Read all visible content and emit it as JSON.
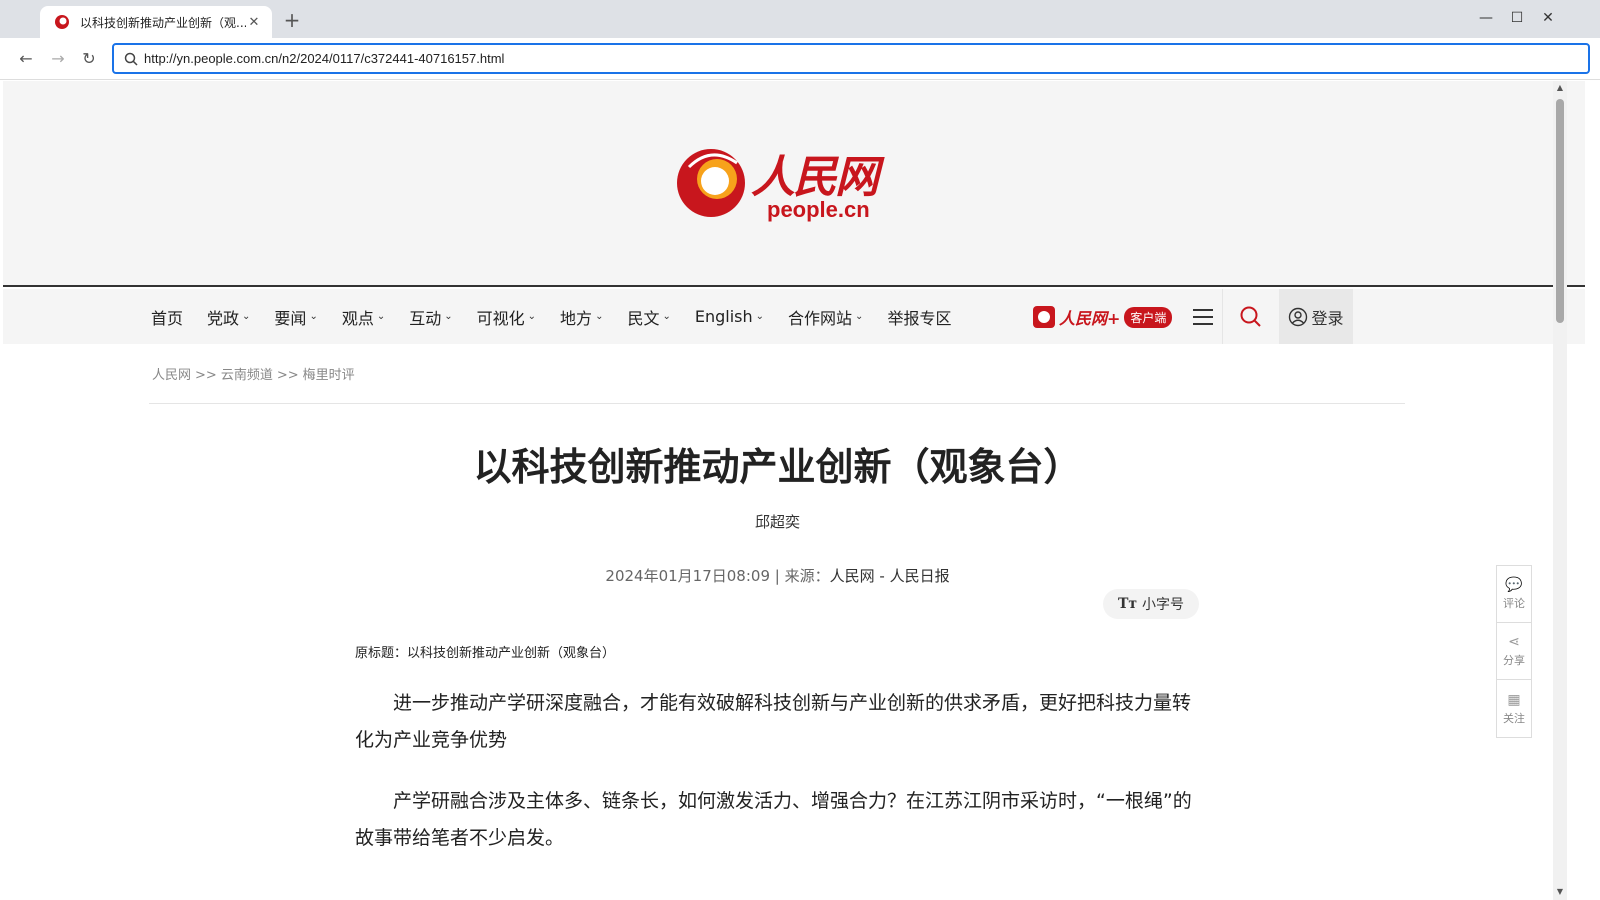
{
  "browser": {
    "tab_title": "以科技创新推动产业创新（观...",
    "tab_close": "✕",
    "new_tab": "+",
    "url": "http://yn.people.com.cn/n2/2024/0117/c372441-40716157.html",
    "window_controls": {
      "minimize": "—",
      "maximize": "☐",
      "close": "✕"
    },
    "nav": {
      "back": "←",
      "forward": "→",
      "reload": "↻"
    }
  },
  "site": {
    "logo_cn": "人民网",
    "logo_en": "people.cn"
  },
  "nav": {
    "items": [
      {
        "label": "首页",
        "dropdown": false
      },
      {
        "label": "党政",
        "dropdown": true
      },
      {
        "label": "要闻",
        "dropdown": true
      },
      {
        "label": "观点",
        "dropdown": true
      },
      {
        "label": "互动",
        "dropdown": true
      },
      {
        "label": "可视化",
        "dropdown": true
      },
      {
        "label": "地方",
        "dropdown": true
      },
      {
        "label": "民文",
        "dropdown": true
      },
      {
        "label": "English",
        "dropdown": true
      },
      {
        "label": "合作网站",
        "dropdown": true
      },
      {
        "label": "举报专区",
        "dropdown": false
      }
    ],
    "app_name": "人民网+",
    "app_tag": "客户端",
    "login": "登录"
  },
  "breadcrumb": [
    "人民网",
    ">>",
    "云南频道",
    ">>",
    "梅里时评"
  ],
  "article": {
    "title": "以科技创新推动产业创新（观象台）",
    "author": "邱超奕",
    "date": "2024年01月17日08:09",
    "separator": "|",
    "source_label": "来源：",
    "source": "人民网 - 人民日报",
    "font_toggle_icon": "Tт",
    "font_toggle": "小字号",
    "original_title": "原标题：以科技创新推动产业创新（观象台）",
    "paragraphs": [
      "进一步推动产学研深度融合，才能有效破解科技创新与产业创新的供求矛盾，更好把科技力量转化为产业竞争优势",
      "产学研融合涉及主体多、链条长，如何激发活力、增强合力？在江苏江阴市采访时，“一根绳”的故事带给笔者不少启发。"
    ]
  },
  "side_tools": [
    {
      "icon": "comment-icon",
      "glyph": "💬",
      "label": "评论"
    },
    {
      "icon": "share-icon",
      "glyph": "⋖",
      "label": "分享"
    },
    {
      "icon": "qrcode-icon",
      "glyph": "▦",
      "label": "关注"
    }
  ],
  "colors": {
    "brand_red": "#c8161d",
    "accent_blue": "#1a73e8"
  }
}
